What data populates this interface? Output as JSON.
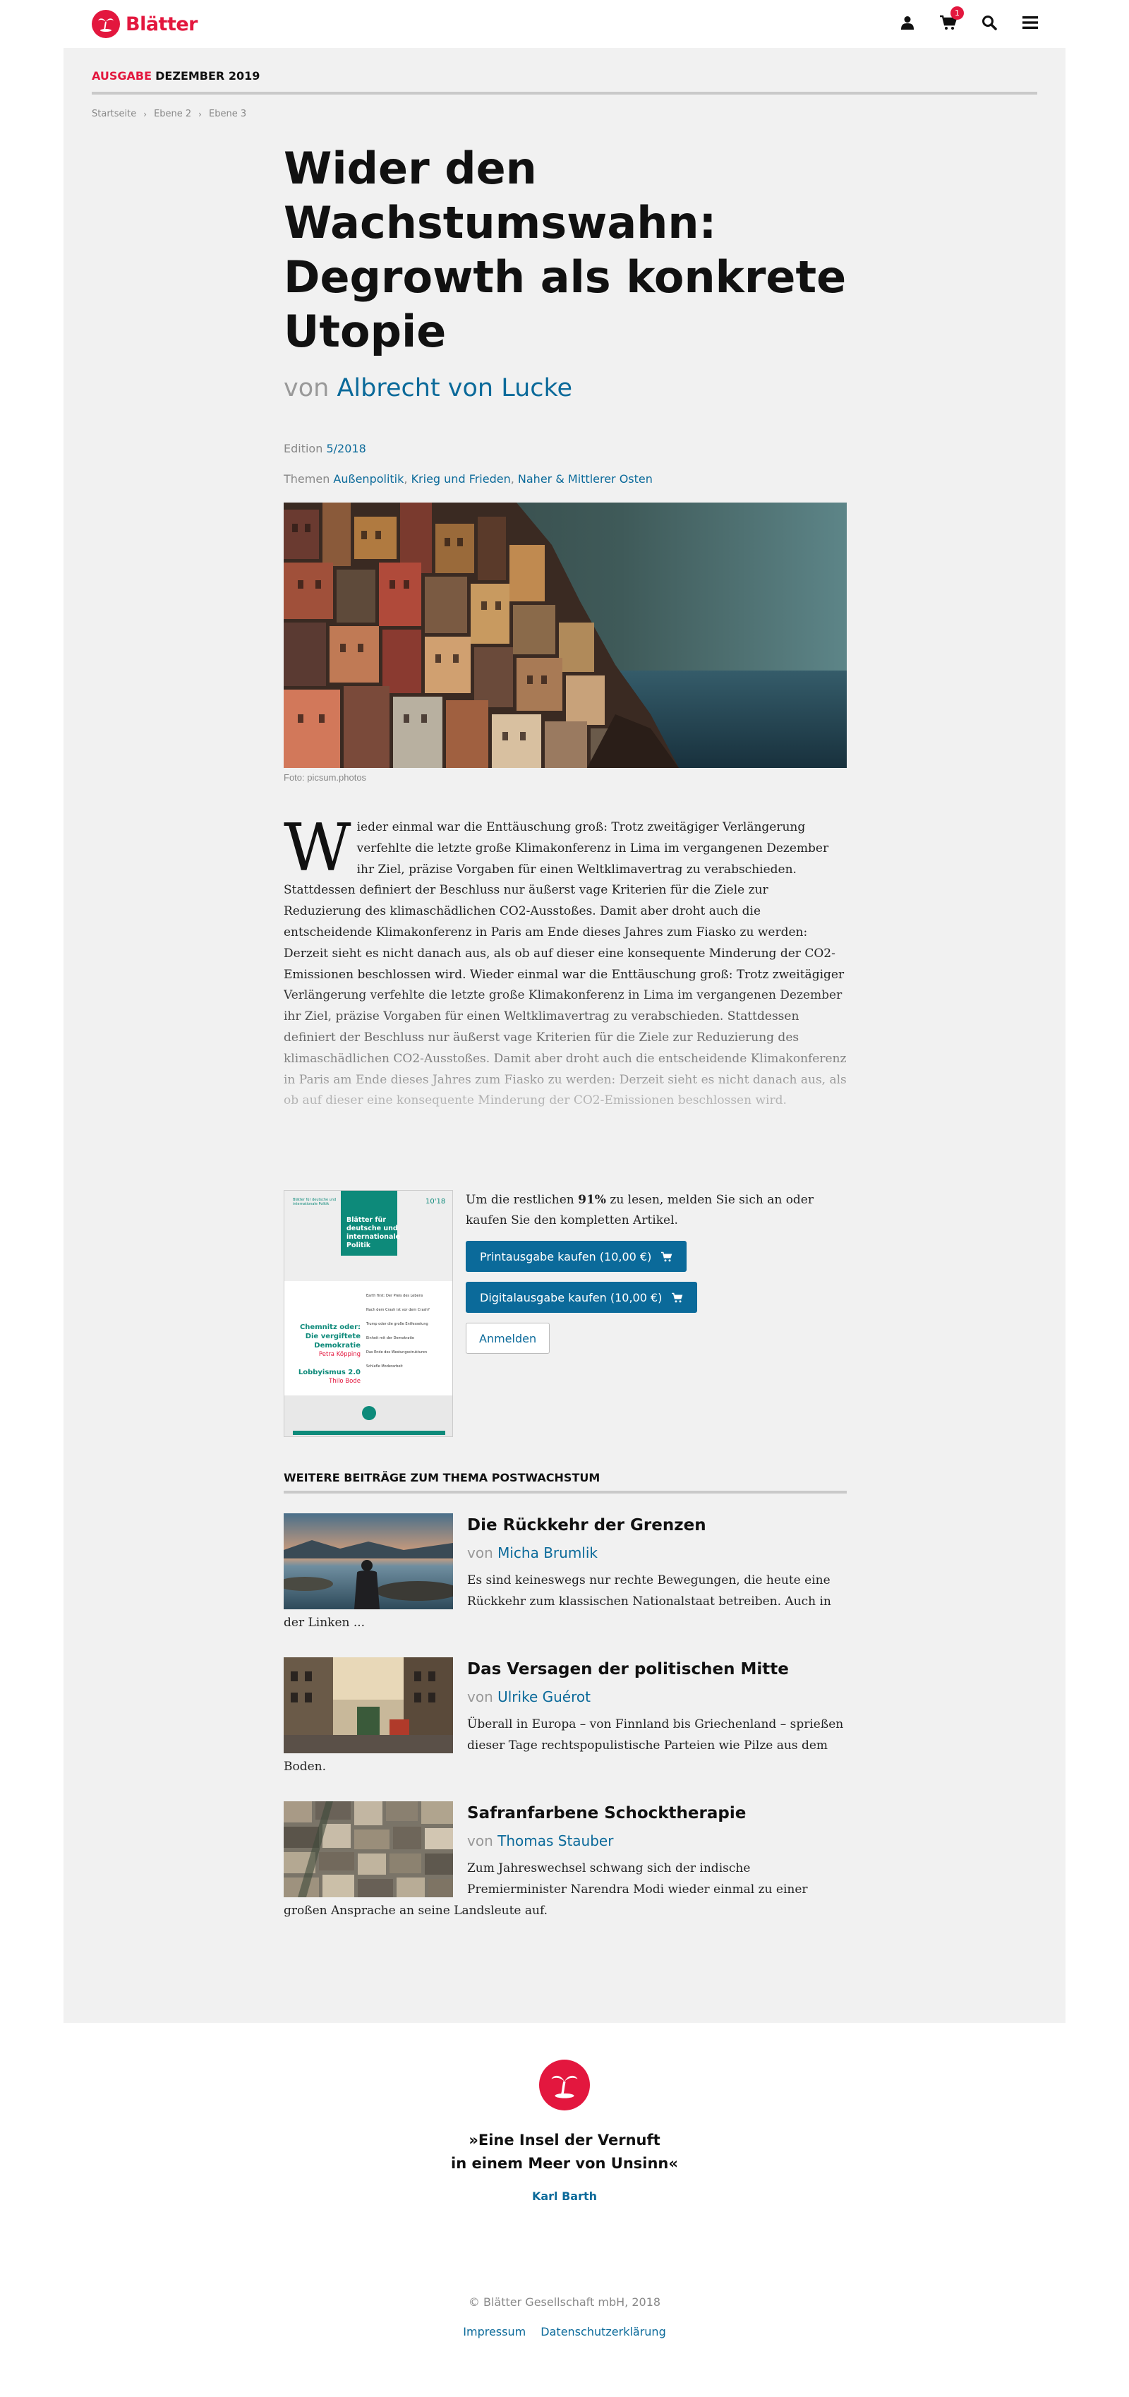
{
  "header": {
    "logo_text": "Blätter",
    "cart_count": "1",
    "icons": [
      "user-icon",
      "cart-icon",
      "search-icon",
      "menu-icon"
    ]
  },
  "issue": {
    "label": "AUSGABE",
    "value": "DEZEMBER 2019"
  },
  "breadcrumb": [
    "Startseite",
    "Ebene 2",
    "Ebene 3"
  ],
  "article": {
    "title": "Wider den Wachstumswahn: Degrowth als konkrete Utopie",
    "by_prefix": "von",
    "author": "Albrecht von Lucke",
    "edition_label": "Edition",
    "edition_value": "5/2018",
    "topics_label": "Themen",
    "topics": [
      "Außenpolitik",
      "Krieg und Frieden",
      "Naher & Mittlerer Osten"
    ],
    "image_caption": "Foto: picsum.photos",
    "dropcap": "W",
    "body": "ieder einmal war die Enttäuschung groß: Trotz zweitägiger Verlängerung verfehlte die letzte große Klimakonferenz in Lima im vergangenen Dezember ihr Ziel, präzise Vorgaben für einen Weltklimavertrag zu verabschieden. Stattdessen definiert der Beschluss nur äußerst vage Kriterien für die Ziele zur Reduzierung des klimaschädlichen CO2-Ausstoßes. Damit aber droht auch die entscheidende Klimakonferenz in Paris am Ende dieses Jahres zum Fiasko zu werden: Derzeit sieht es nicht danach aus, als ob auf dieser eine konsequente Minderung der CO2-Emissionen beschlossen wird. Wieder einmal war die Enttäuschung groß: Trotz zweitägiger Verlängerung verfehlte die letzte große Klimakonferenz in Lima im vergangenen Dezember ihr Ziel, präzise Vorgaben für einen Weltklimavertrag zu verabschieden. Stattdessen definiert der Beschluss nur äußerst vage Kriterien für die Ziele zur Reduzierung des klimaschädlichen CO2-Ausstoßes. Damit aber droht auch die entscheidende Klimakonferenz in Paris am Ende dieses Jahres zum Fiasko zu werden: Derzeit sieht es nicht danach aus, als ob auf dieser eine konsequente Minderung der CO2-Emissionen beschlossen wird."
  },
  "paywall": {
    "text_before": "Um die restlichen ",
    "percent": "91%",
    "text_after": " zu lesen, melden Sie sich an oder kaufen Sie den kompletten Artikel.",
    "print_button": "Printausgabe kaufen   (10,00 €)",
    "digital_button": "Digitalausgabe kaufen   (10,00 €)",
    "login_button": "Anmelden",
    "cover": {
      "top_left": "Blätter für deutsche und internationale Politik",
      "issue": "10'18",
      "title": "Blätter für deutsche und internationale Politik",
      "headline1": "Chemnitz oder: Die vergiftete Demokratie",
      "author1": "Petra Köpping",
      "headline2": "Lobbyismus 2.0",
      "author2": "Thilo Bode",
      "toc": [
        "Earth first: Der Preis des Lebens",
        "Nach dem Crash ist vor dem Crash?",
        "Trump oder die große Entfesselung",
        "Einheit mit der Demokratie: Die gegen Negern und Nazis",
        "Das Ende des Westungsstrukturen",
        "Schlafle Moderarbeit"
      ]
    }
  },
  "related": {
    "heading": "WEITERE BEITRÄGE ZUM THEMA POSTWACHSTUM",
    "items": [
      {
        "title": "Die Rückkehr der Grenzen",
        "by_prefix": "von",
        "author": "Micha Brumlik",
        "teaser": "Es sind keineswegs nur rechte Bewegungen, die heute eine Rückkehr zum klassischen Nationalstaat betreiben. Auch in der Linken ..."
      },
      {
        "title": "Das Versagen der politischen Mitte",
        "by_prefix": "von",
        "author": "Ulrike Guérot",
        "teaser": "Überall in Europa – von Finnland bis Griechenland – sprießen dieser Tage rechtspopulistische Parteien wie Pilze aus dem Boden."
      },
      {
        "title": "Safranfarbene Schocktherapie",
        "by_prefix": "von",
        "author": "Thomas Stauber",
        "teaser": "Zum Jahreswechsel schwang sich der indische Premierminister Narendra Modi wieder einmal zu einer großen Ansprache an seine Landsleute auf."
      }
    ]
  },
  "footer": {
    "quote_line1": "»Eine Insel der Vernuft",
    "quote_line2": "in einem Meer von Unsinn«",
    "quote_author": "Karl Barth",
    "copyright": "© Blätter Gesellschaft mbH, 2018",
    "links": [
      "Impressum",
      "Datenschutzerklärung"
    ]
  },
  "colors": {
    "brand_red": "#e3173e",
    "link_blue": "#0b6a9a",
    "panel_gray": "#f1f1f1",
    "cover_teal": "#0d8a7a"
  }
}
